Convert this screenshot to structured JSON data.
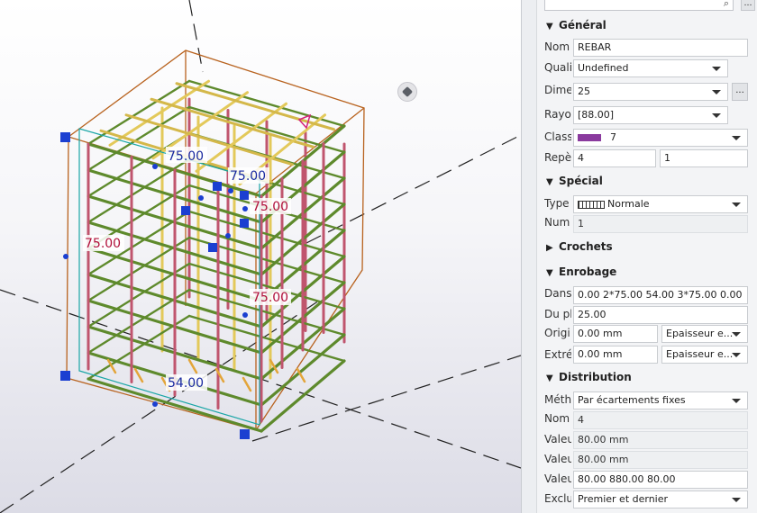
{
  "viewport": {
    "dimensions": [
      "75.00",
      "75.00",
      "75.00",
      "75.00",
      "75.00",
      "54.00"
    ]
  },
  "panel": {
    "search_placeholder": "",
    "top_button": "…",
    "sections": {
      "general": "Général",
      "special": "Spécial",
      "hooks": "Crochets",
      "cover": "Enrobage",
      "distribution": "Distribution"
    },
    "general": {
      "name_label": "Nom",
      "name_value": "REBAR",
      "quality_label": "Quali",
      "quality_value": "Undefined",
      "dimension_label": "Dime",
      "dimension_value": "25",
      "dimension_more": "...",
      "radius_label": "Rayon",
      "radius_value": "[88.00]",
      "class_label": "Class",
      "class_value": "7",
      "class_color": "#8a3a9e",
      "mark_label": "Repè",
      "mark_prefix": "4",
      "mark_start": "1"
    },
    "special": {
      "type_label": "Type",
      "type_value": "Normale",
      "number_label": "Num",
      "number_value": "1"
    },
    "cover": {
      "plane_label": "Dans",
      "plane_value": "0.00 2*75.00 54.00 3*75.00 0.00",
      "from_plane_label": "Du pl",
      "from_plane_value": "25.00",
      "start_label": "Origi",
      "start_value": "0.00 mm",
      "start_mode": "Epaisseur e...",
      "end_label": "Extré",
      "end_value": "0.00 mm",
      "end_mode": "Epaisseur e..."
    },
    "distribution": {
      "method_label": "Méth",
      "method_value": "Par écartements fixes",
      "count_label": "Nom",
      "count_value": "4",
      "value1_label": "Valeu",
      "value1": "80.00 mm",
      "value2_label": "Valeu",
      "value2": "80.00 mm",
      "value3_label": "Valeu",
      "value3": "80.00 880.00 80.00",
      "exclude_label": "Exclu",
      "exclude_value": "Premier et dernier"
    }
  }
}
